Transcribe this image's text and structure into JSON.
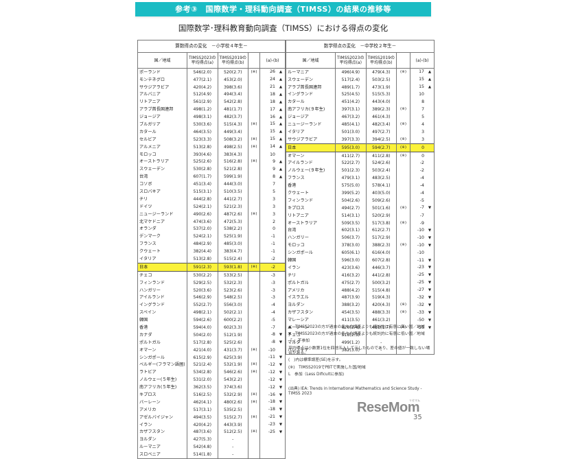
{
  "banner": "参考③　国際数学・理科動向調査（TIMSS）の結果の推移等",
  "subtitle": "国際数学･理科教育動向調査（TIMSS）における得点の変化",
  "headers": {
    "country": "国／地域",
    "a_line1": "TIMSS2023の",
    "a_line2": "平均得点(a)",
    "b_line1": "TIMSS2019の",
    "b_line2": "平均得点(b)",
    "diff": "(a)-(b)"
  },
  "left_table": {
    "caption": "算数得点の変化　－小学校４年生－",
    "rows": [
      {
        "country": "ポーランド",
        "a": "546(2.0)",
        "b": "520(2.7)",
        "note": "(※)",
        "diff": "26",
        "arrow": "up"
      },
      {
        "country": "モンテネグロ",
        "a": "477(2.1)",
        "b": "453(2.0)",
        "note": "",
        "diff": "24",
        "arrow": "up"
      },
      {
        "country": "サウジアラビア",
        "a": "420(4.2)",
        "b": "398(3.6)",
        "note": "",
        "diff": "21",
        "arrow": "up"
      },
      {
        "country": "アルバニア",
        "a": "512(4.9)",
        "b": "494(3.4)",
        "note": "",
        "diff": "18",
        "arrow": "up"
      },
      {
        "country": "リトアニア",
        "a": "561(2.9)",
        "b": "542(2.8)",
        "note": "",
        "diff": "18",
        "arrow": "up"
      },
      {
        "country": "アラブ首長国連邦",
        "a": "498(1.2)",
        "b": "481(1.7)",
        "note": "",
        "diff": "17",
        "arrow": "up"
      },
      {
        "country": "ジョージア",
        "a": "498(3.1)",
        "b": "482(3.7)",
        "note": "",
        "diff": "16",
        "arrow": "up"
      },
      {
        "country": "ブルガリア",
        "a": "530(3.6)",
        "b": "515(4.3)",
        "note": "(※)",
        "diff": "15",
        "arrow": "up"
      },
      {
        "country": "カタール",
        "a": "464(3.5)",
        "b": "449(3.4)",
        "note": "",
        "diff": "15",
        "arrow": "up"
      },
      {
        "country": "セルビア",
        "a": "523(3.3)",
        "b": "508(3.2)",
        "note": "(※)",
        "diff": "15",
        "arrow": "up"
      },
      {
        "country": "アルメニア",
        "a": "513(2.8)",
        "b": "498(2.5)",
        "note": "(※)",
        "diff": "14",
        "arrow": "up"
      },
      {
        "country": "モロッコ",
        "a": "393(4.6)",
        "b": "383(4.3)",
        "note": "",
        "diff": "10",
        "arrow": ""
      },
      {
        "country": "オーストラリア",
        "a": "525(2.6)",
        "b": "516(2.8)",
        "note": "(※)",
        "diff": "9",
        "arrow": "up"
      },
      {
        "country": "スウェーデン",
        "a": "530(2.8)",
        "b": "521(2.8)",
        "note": "",
        "diff": "9",
        "arrow": "up"
      },
      {
        "country": "台湾",
        "a": "607(1.7)",
        "b": "599(1.9)",
        "note": "",
        "diff": "8",
        "arrow": "up"
      },
      {
        "country": "コソボ",
        "a": "451(3.4)",
        "b": "444(3.0)",
        "note": "",
        "diff": "7",
        "arrow": ""
      },
      {
        "country": "スロバキア",
        "a": "515(3.1)",
        "b": "510(3.5)",
        "note": "",
        "diff": "5",
        "arrow": ""
      },
      {
        "country": "チリ",
        "a": "444(2.8)",
        "b": "441(2.7)",
        "note": "",
        "diff": "3",
        "arrow": ""
      },
      {
        "country": "ドイツ",
        "a": "524(2.1)",
        "b": "521(2.3)",
        "note": "",
        "diff": "3",
        "arrow": ""
      },
      {
        "country": "ニュージーランド",
        "a": "490(2.6)",
        "b": "487(2.6)",
        "note": "(※)",
        "diff": "3",
        "arrow": ""
      },
      {
        "country": "北マケドニア",
        "a": "474(3.6)",
        "b": "472(5.3)",
        "note": "",
        "diff": "2",
        "arrow": ""
      },
      {
        "country": "オランダ",
        "a": "537(2.0)",
        "b": "538(2.2)",
        "note": "",
        "diff": "0",
        "arrow": ""
      },
      {
        "country": "デンマーク",
        "a": "524(2.1)",
        "b": "525(1.9)",
        "note": "",
        "diff": "-1",
        "arrow": ""
      },
      {
        "country": "フランス",
        "a": "484(2.9)",
        "b": "485(3.0)",
        "note": "",
        "diff": "-1",
        "arrow": ""
      },
      {
        "country": "クウェート",
        "a": "382(4.4)",
        "b": "383(4.7)",
        "note": "",
        "diff": "-1",
        "arrow": ""
      },
      {
        "country": "イタリア",
        "a": "513(2.8)",
        "b": "515(2.4)",
        "note": "",
        "diff": "-2",
        "arrow": ""
      },
      {
        "country": "日本",
        "a": "591(2.3)",
        "b": "593(1.8)",
        "note": "(※)",
        "diff": "-2",
        "arrow": "",
        "highlight": true
      },
      {
        "country": "チェコ",
        "a": "530(2.2)",
        "b": "533(2.5)",
        "note": "",
        "diff": "-3",
        "arrow": ""
      },
      {
        "country": "フィンランド",
        "a": "529(2.5)",
        "b": "532(2.3)",
        "note": "",
        "diff": "-3",
        "arrow": ""
      },
      {
        "country": "ハンガリー",
        "a": "520(3.6)",
        "b": "523(2.6)",
        "note": "",
        "diff": "-3",
        "arrow": ""
      },
      {
        "country": "アイルランド",
        "a": "546(2.9)",
        "b": "548(2.5)",
        "note": "",
        "diff": "-3",
        "arrow": ""
      },
      {
        "country": "イングランド",
        "a": "552(2.7)",
        "b": "556(3.0)",
        "note": "",
        "diff": "-4",
        "arrow": ""
      },
      {
        "country": "スペイン",
        "a": "498(2.1)",
        "b": "502(2.1)",
        "note": "",
        "diff": "-4",
        "arrow": ""
      },
      {
        "country": "韓国",
        "a": "594(2.6)",
        "b": "600(2.2)",
        "note": "",
        "diff": "-5",
        "arrow": ""
      },
      {
        "country": "香港",
        "a": "594(4.0)",
        "b": "602(3.3)",
        "note": "",
        "diff": "-7",
        "arrow": ""
      },
      {
        "country": "カナダ",
        "a": "504(2.0)",
        "b": "512(1.9)",
        "note": "",
        "diff": "-8",
        "arrow": "down"
      },
      {
        "country": "ポルトガル",
        "a": "517(2.8)",
        "b": "525(2.6)",
        "note": "",
        "diff": "-8",
        "arrow": "down"
      },
      {
        "country": "オマーン",
        "a": "421(4.0)",
        "b": "431(3.7)",
        "note": "(※)",
        "diff": "-10",
        "arrow": ""
      },
      {
        "country": "シンガポール",
        "a": "615(2.9)",
        "b": "625(3.9)",
        "note": "",
        "diff": "-11",
        "arrow": "down"
      },
      {
        "country": "ベルギー(フラマン語圏)",
        "a": "521(2.4)",
        "b": "532(1.9)",
        "note": "(※)",
        "diff": "-12",
        "arrow": "down"
      },
      {
        "country": "ラトビア",
        "a": "534(2.8)",
        "b": "546(2.6)",
        "note": "(※)",
        "diff": "-12",
        "arrow": "down"
      },
      {
        "country": "ノルウェー(５年生)",
        "a": "531(2.0)",
        "b": "543(2.2)",
        "note": "",
        "diff": "-12",
        "arrow": "down"
      },
      {
        "country": "南アフリカ(５年生)",
        "a": "362(3.5)",
        "b": "374(3.6)",
        "note": "",
        "diff": "-12",
        "arrow": "down"
      },
      {
        "country": "キプロス",
        "a": "516(2.5)",
        "b": "532(2.9)",
        "note": "(※)",
        "diff": "-16",
        "arrow": "down"
      },
      {
        "country": "バーレーン",
        "a": "462(4.1)",
        "b": "480(2.6)",
        "note": "(※)",
        "diff": "-18",
        "arrow": "down"
      },
      {
        "country": "アメリカ",
        "a": "517(3.1)",
        "b": "535(2.5)",
        "note": "",
        "diff": "-18",
        "arrow": "down"
      },
      {
        "country": "アゼルバイジャン",
        "a": "494(3.5)",
        "b": "515(2.7)",
        "note": "(※)",
        "diff": "-21",
        "arrow": "down"
      },
      {
        "country": "イラン",
        "a": "420(4.2)",
        "b": "443(3.9)",
        "note": "",
        "diff": "-23",
        "arrow": "down"
      },
      {
        "country": "カザフスタン",
        "a": "487(3.6)",
        "b": "512(2.5)",
        "note": "(※)",
        "diff": "-25",
        "arrow": "down"
      },
      {
        "country": "ヨルダン",
        "a": "427(5.3)",
        "b": "-",
        "note": "",
        "diff": "",
        "arrow": ""
      },
      {
        "country": "ルーマニア",
        "a": "542(4.8)",
        "b": "-",
        "note": "",
        "diff": "",
        "arrow": ""
      },
      {
        "country": "スロベニア",
        "a": "514(1.8)",
        "b": "-",
        "note": "",
        "diff": "",
        "arrow": ""
      }
    ]
  },
  "right_table": {
    "caption": "数学得点の変化　－中学校２年生－",
    "rows": [
      {
        "country": "ルーマニア",
        "a": "496(4.9)",
        "b": "479(4.3)",
        "note": "(※)",
        "diff": "17",
        "arrow": "up"
      },
      {
        "country": "スウェーデン",
        "a": "517(2.4)",
        "b": "503(2.5)",
        "note": "",
        "diff": "15",
        "arrow": "up"
      },
      {
        "country": "アラブ首長国連邦",
        "a": "489(1.7)",
        "b": "473(1.9)",
        "note": "",
        "diff": "15",
        "arrow": "up"
      },
      {
        "country": "イングランド",
        "a": "525(4.5)",
        "b": "515(5.3)",
        "note": "",
        "diff": "10",
        "arrow": ""
      },
      {
        "country": "カタール",
        "a": "451(4.2)",
        "b": "443(4.0)",
        "note": "",
        "diff": "8",
        "arrow": ""
      },
      {
        "country": "南アフリカ(９年生)",
        "a": "397(3.1)",
        "b": "389(2.3)",
        "note": "(※)",
        "diff": "7",
        "arrow": ""
      },
      {
        "country": "ジョージア",
        "a": "467(3.2)",
        "b": "461(4.3)",
        "note": "",
        "diff": "5",
        "arrow": ""
      },
      {
        "country": "ニュージーランド",
        "a": "485(4.1)",
        "b": "482(3.4)",
        "note": "(※)",
        "diff": "4",
        "arrow": ""
      },
      {
        "country": "イタリア",
        "a": "501(3.0)",
        "b": "497(2.7)",
        "note": "",
        "diff": "3",
        "arrow": ""
      },
      {
        "country": "サウジアラビア",
        "a": "397(3.3)",
        "b": "394(2.5)",
        "note": "(※)",
        "diff": "3",
        "arrow": ""
      },
      {
        "country": "日本",
        "a": "595(3.0)",
        "b": "594(2.7)",
        "note": "(※)",
        "diff": "0",
        "arrow": "",
        "highlight": true
      },
      {
        "country": "オマーン",
        "a": "411(2.7)",
        "b": "411(2.8)",
        "note": "(※)",
        "diff": "0",
        "arrow": ""
      },
      {
        "country": "アイルランド",
        "a": "522(2.7)",
        "b": "524(2.6)",
        "note": "",
        "diff": "-2",
        "arrow": ""
      },
      {
        "country": "ノルウェー(９年生)",
        "a": "501(2.3)",
        "b": "503(2.4)",
        "note": "",
        "diff": "-2",
        "arrow": ""
      },
      {
        "country": "フランス",
        "a": "479(3.1)",
        "b": "483(2.5)",
        "note": "",
        "diff": "-4",
        "arrow": ""
      },
      {
        "country": "香港",
        "a": "575(5.0)",
        "b": "578(4.1)",
        "note": "",
        "diff": "-4",
        "arrow": ""
      },
      {
        "country": "クウェート",
        "a": "399(5.2)",
        "b": "403(5.0)",
        "note": "",
        "diff": "-4",
        "arrow": ""
      },
      {
        "country": "フィンランド",
        "a": "504(2.6)",
        "b": "509(2.6)",
        "note": "",
        "diff": "-5",
        "arrow": ""
      },
      {
        "country": "キプロス",
        "a": "494(2.7)",
        "b": "501(1.6)",
        "note": "(※)",
        "diff": "-7",
        "arrow": "down"
      },
      {
        "country": "リトアニア",
        "a": "514(3.1)",
        "b": "520(2.9)",
        "note": "",
        "diff": "-7",
        "arrow": ""
      },
      {
        "country": "オーストラリア",
        "a": "509(3.5)",
        "b": "517(3.8)",
        "note": "(※)",
        "diff": "-9",
        "arrow": ""
      },
      {
        "country": "台湾",
        "a": "602(3.1)",
        "b": "612(2.7)",
        "note": "",
        "diff": "-10",
        "arrow": "down"
      },
      {
        "country": "ハンガリー",
        "a": "506(3.7)",
        "b": "517(2.9)",
        "note": "",
        "diff": "-10",
        "arrow": "down"
      },
      {
        "country": "モロッコ",
        "a": "378(3.0)",
        "b": "388(2.3)",
        "note": "(※)",
        "diff": "-10",
        "arrow": "down"
      },
      {
        "country": "シンガポール",
        "a": "605(6.1)",
        "b": "616(4.0)",
        "note": "",
        "diff": "-10",
        "arrow": ""
      },
      {
        "country": "韓国",
        "a": "596(3.0)",
        "b": "607(2.8)",
        "note": "",
        "diff": "-11",
        "arrow": "down"
      },
      {
        "country": "イラン",
        "a": "423(3.6)",
        "b": "446(3.7)",
        "note": "",
        "diff": "-23",
        "arrow": "down"
      },
      {
        "country": "チリ",
        "a": "416(3.2)",
        "b": "441(2.8)",
        "note": "",
        "diff": "-25",
        "arrow": "down"
      },
      {
        "country": "ポルトガル",
        "a": "475(2.7)",
        "b": "500(3.2)",
        "note": "",
        "diff": "-25",
        "arrow": "down"
      },
      {
        "country": "アメリカ",
        "a": "488(4.2)",
        "b": "515(4.8)",
        "note": "",
        "diff": "-27",
        "arrow": "down"
      },
      {
        "country": "イスラエル",
        "a": "487(3.9)",
        "b": "519(4.3)",
        "note": "",
        "diff": "-32",
        "arrow": "down"
      },
      {
        "country": "ヨルダン",
        "a": "388(3.2)",
        "b": "420(4.3)",
        "note": "(※)",
        "diff": "-32",
        "arrow": "down"
      },
      {
        "country": "カザフスタン",
        "a": "454(3.5)",
        "b": "488(3.3)",
        "note": "(※)",
        "diff": "-33",
        "arrow": "down"
      },
      {
        "country": "マレーシア",
        "a": "411(3.5)",
        "b": "461(3.2)",
        "note": "",
        "diff": "-50",
        "arrow": "down"
      },
      {
        "country": "バーレーン",
        "a": "426(2.4)",
        "b": "481(1.7)",
        "note": "(※)",
        "diff": "-55",
        "arrow": "down"
      },
      {
        "country": "チェコ",
        "a": "518(2.3)",
        "b": "-",
        "note": "",
        "diff": "",
        "arrow": ""
      },
      {
        "country": "マルタ",
        "a": "499(1.2)",
        "b": "-",
        "note": "",
        "diff": "",
        "arrow": ""
      },
      {
        "country": "パレスチナ",
        "a": "382(3.0)",
        "b": "-",
        "note": "",
        "diff": "",
        "arrow": ""
      }
    ]
  },
  "legend": {
    "up_text": "TIMSS2023の方が過去の各々の調査よりも統計的に有意に高い国／地域",
    "down_text": "TIMSS2023の方が過去の各々の調査よりも統計的に有意に低い国／地域",
    "dash_text": "「-」不参加",
    "rounding_text": "平均得点は小数第1位を四捨五入して示したものであり、差の値が一致しない場合がある。",
    "se_text": "(　)内は標準誤差(SE)を示す。",
    "pbt_text": "(※)　TIMSS2019でPBTで実施した国/地域",
    "less_difficult_text": "L　参加（Less Dificultに参加)"
  },
  "source": "(出典) IEA: Trends in International Mathematics and Science Study - TIMSS 2023",
  "logo": {
    "text": "ReseMom",
    "kana": "リセマム"
  },
  "page_number": "35",
  "colors": {
    "banner": "#1bbcc4",
    "highlight": "#fbf23a"
  }
}
